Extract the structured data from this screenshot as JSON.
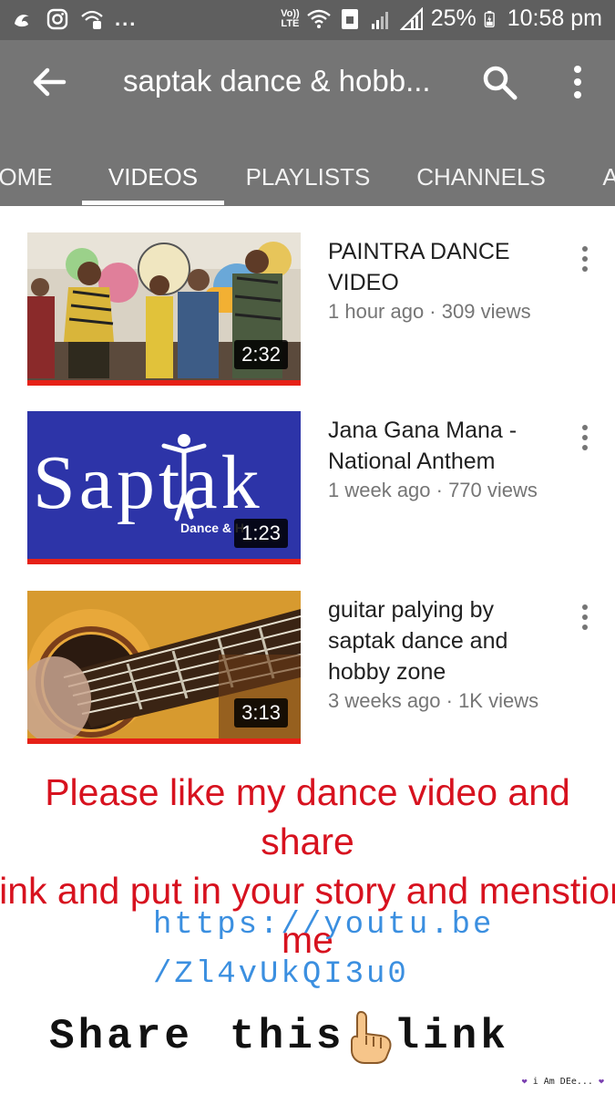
{
  "status_bar": {
    "volte": "Vo))\nLTE",
    "battery": "25%",
    "time": "10:58 pm",
    "overflow_dots": "..."
  },
  "app_bar": {
    "title": "saptak dance & hobb...",
    "tabs": [
      "OME",
      "VIDEOS",
      "PLAYLISTS",
      "CHANNELS",
      "A"
    ],
    "selected_tab": "VIDEOS"
  },
  "videos": [
    {
      "title": "PAINTRA DANCE VIDEO",
      "meta": "1 hour ago · 309 views",
      "duration": "2:32",
      "thumbnail": "dance-group-thumbnail"
    },
    {
      "title": "Jana Gana Mana - National Anthem",
      "meta": "1 week ago · 770 views",
      "duration": "1:23",
      "thumbnail": "saptak-logo-thumbnail",
      "thumb_text": "Saptak",
      "thumb_subtext": "Dance & H"
    },
    {
      "title": "guitar palying by saptak dance and hobby zone",
      "meta": "3 weeks ago · 1K views",
      "duration": "3:13",
      "thumbnail": "guitar-thumbnail"
    }
  ],
  "overlay": {
    "appeal_line1": "Please like my dance video and share",
    "appeal_line2": "link and put in your story and menstion",
    "appeal_line3": "me",
    "link_line1": "https://youtu.be",
    "link_line2": "/Zl4vUkQI3u0",
    "share_word1": "Share",
    "share_word2": "this",
    "share_word3": "link",
    "watermark": "i Am DEe..."
  },
  "colors": {
    "status_bar": "#5f5f5f",
    "app_bar": "#757575",
    "progress_red": "#e62117",
    "appeal_red": "#d7121f",
    "link_blue": "#3b8fe0"
  }
}
